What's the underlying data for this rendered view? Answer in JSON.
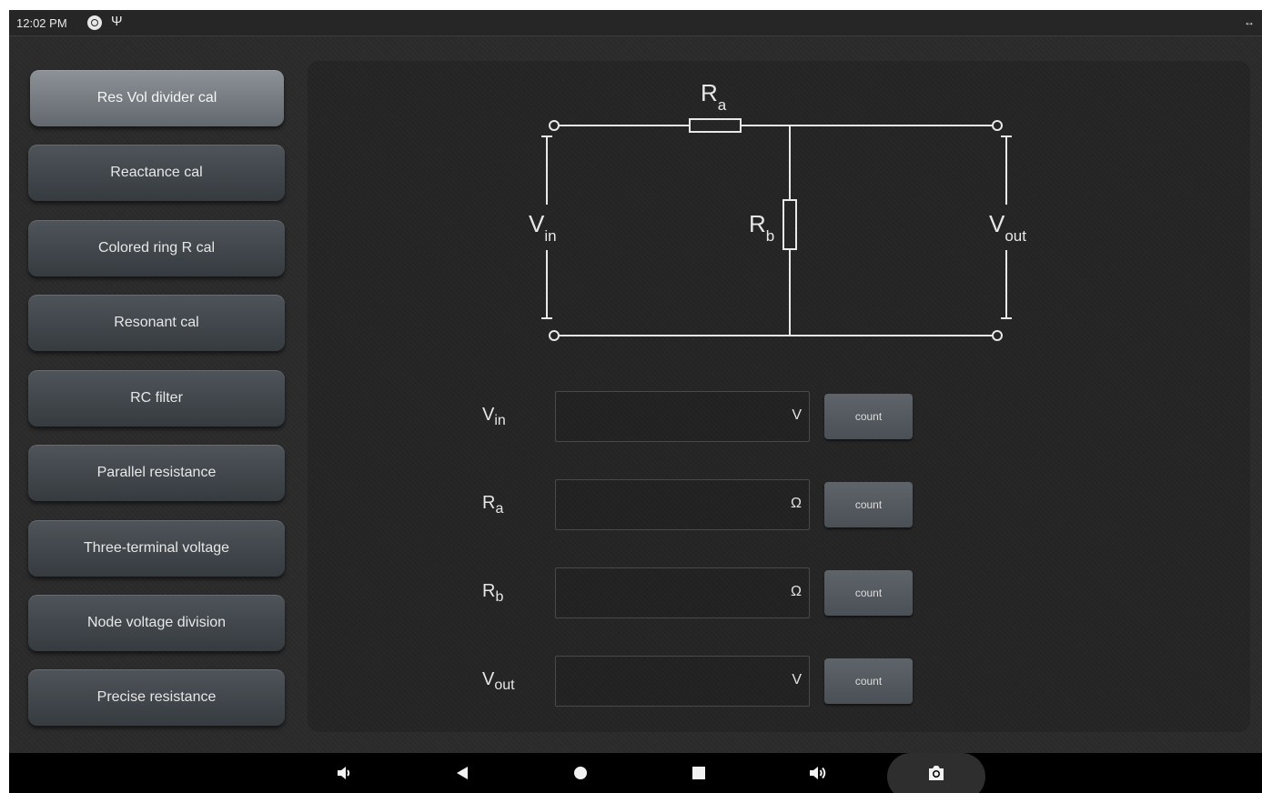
{
  "status_bar": {
    "time": "12:02 PM",
    "icons": [
      "camera-circle-icon",
      "usb-icon"
    ],
    "right_icon": "rotate-arrows-icon"
  },
  "sidebar": {
    "items": [
      {
        "label": "Res Vol divider cal",
        "active": true
      },
      {
        "label": "Reactance cal",
        "active": false
      },
      {
        "label": "Colored ring R cal",
        "active": false
      },
      {
        "label": "Resonant cal",
        "active": false
      },
      {
        "label": "RC filter",
        "active": false
      },
      {
        "label": "Parallel resistance",
        "active": false
      },
      {
        "label": "Three-terminal voltage",
        "active": false
      },
      {
        "label": "Node voltage division",
        "active": false
      },
      {
        "label": "Precise resistance",
        "active": false
      }
    ]
  },
  "diagram": {
    "ra": {
      "main": "R",
      "sub": "a"
    },
    "rb": {
      "main": "R",
      "sub": "b"
    },
    "vin": {
      "main": "V",
      "sub": "in"
    },
    "vout": {
      "main": "V",
      "sub": "out"
    }
  },
  "form": {
    "fields": [
      {
        "main": "V",
        "sub": "in",
        "unit": "V",
        "value": "",
        "button": "count"
      },
      {
        "main": "R",
        "sub": "a",
        "unit": "Ω",
        "value": "",
        "button": "count"
      },
      {
        "main": "R",
        "sub": "b",
        "unit": "Ω",
        "value": "",
        "button": "count"
      },
      {
        "main": "V",
        "sub": "out",
        "unit": "V",
        "value": "",
        "button": "count"
      }
    ]
  },
  "nav_bar": {
    "icons": [
      "volume-down-icon",
      "back-icon",
      "home-icon",
      "recents-icon",
      "volume-up-icon",
      "screenshot-camera-icon"
    ]
  },
  "colors": {
    "background": "#2b2b2b",
    "button": "#42484d",
    "active_button": "#767c81",
    "text": "#e6e6e6"
  }
}
